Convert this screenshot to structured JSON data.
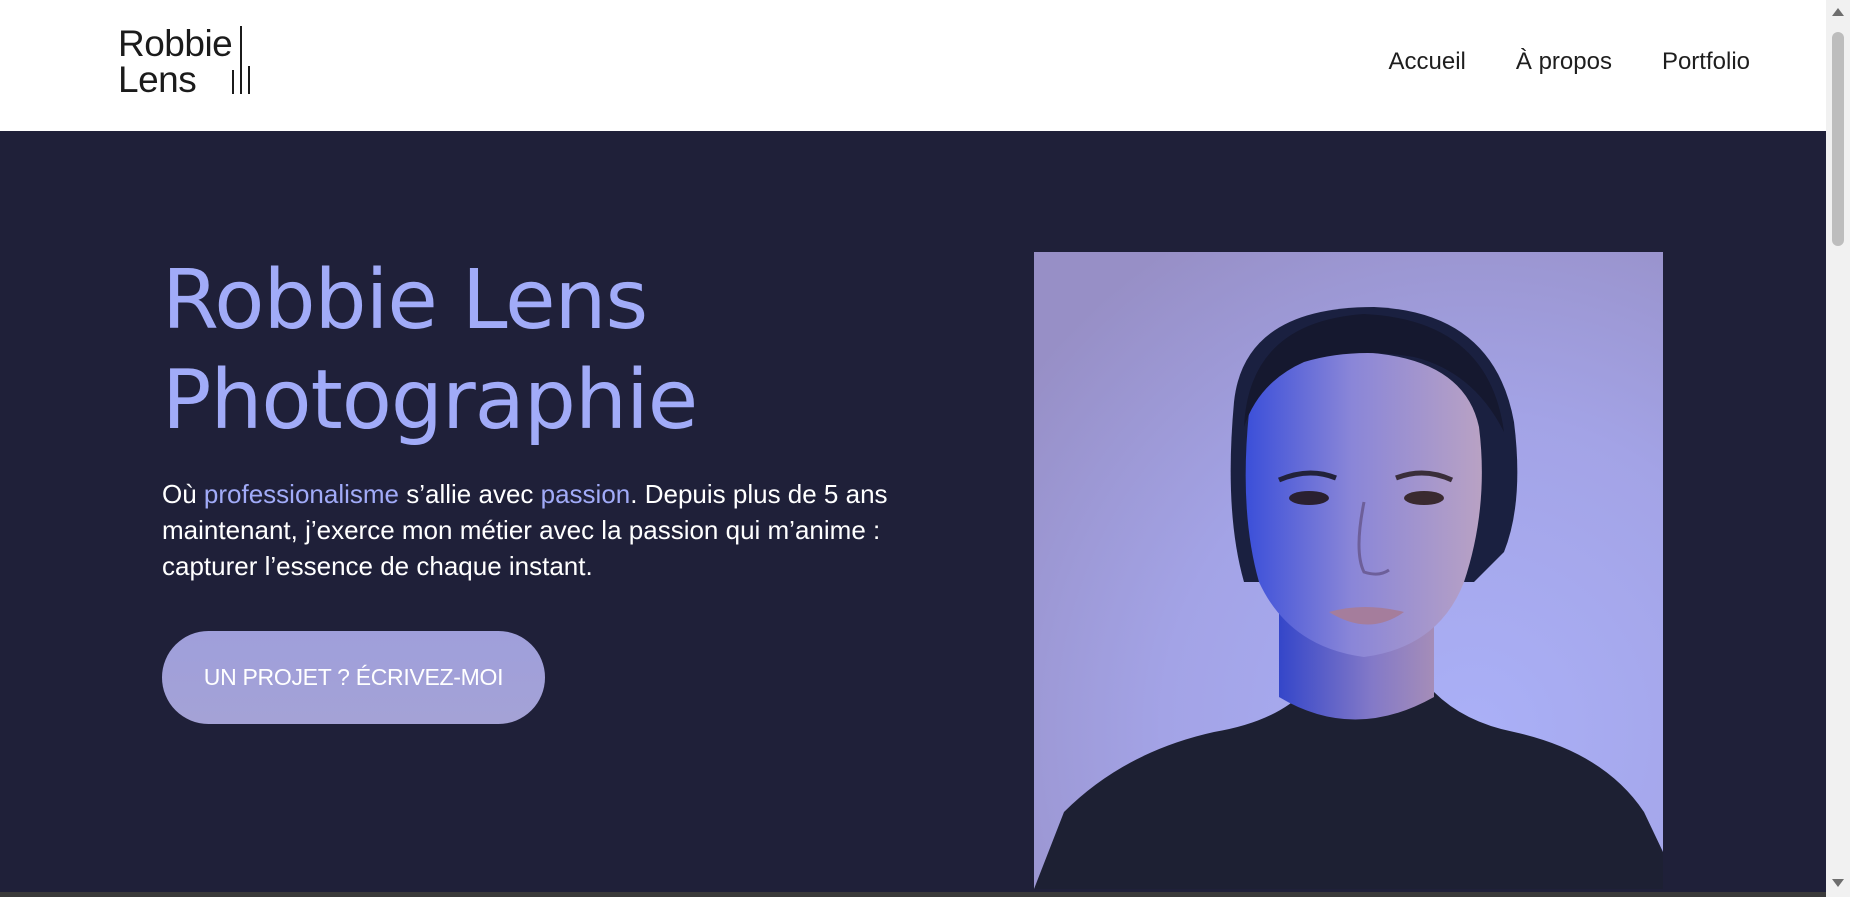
{
  "header": {
    "logo": {
      "line1": "Robbie",
      "line2": "Lens"
    },
    "nav": [
      {
        "label": "Accueil"
      },
      {
        "label": "À propos"
      },
      {
        "label": "Portfolio"
      }
    ]
  },
  "hero": {
    "title_line1": "Robbie Lens",
    "title_line2": "Photographie",
    "intro_prefix": "Où ",
    "intro_highlight1": "professionalisme",
    "intro_middle": " s’allie avec ",
    "intro_highlight2": "passion",
    "intro_rest": ". Depuis plus de 5 ans maintenant, j’exerce mon métier avec la passion qui m’anime : capturer l’essence de chaque instant.",
    "cta_label": "UN PROJET ? ÉCRIVEZ-MOI"
  },
  "colors": {
    "background": "#1f2039",
    "accent": "#a1abf8",
    "header_bg": "#ffffff",
    "cta_bg": "#a29fd9"
  },
  "icons": {
    "logo_bars": "vertical-bars-icon",
    "scroll_up": "scroll-up-arrow-icon",
    "scroll_down": "scroll-down-arrow-icon"
  }
}
